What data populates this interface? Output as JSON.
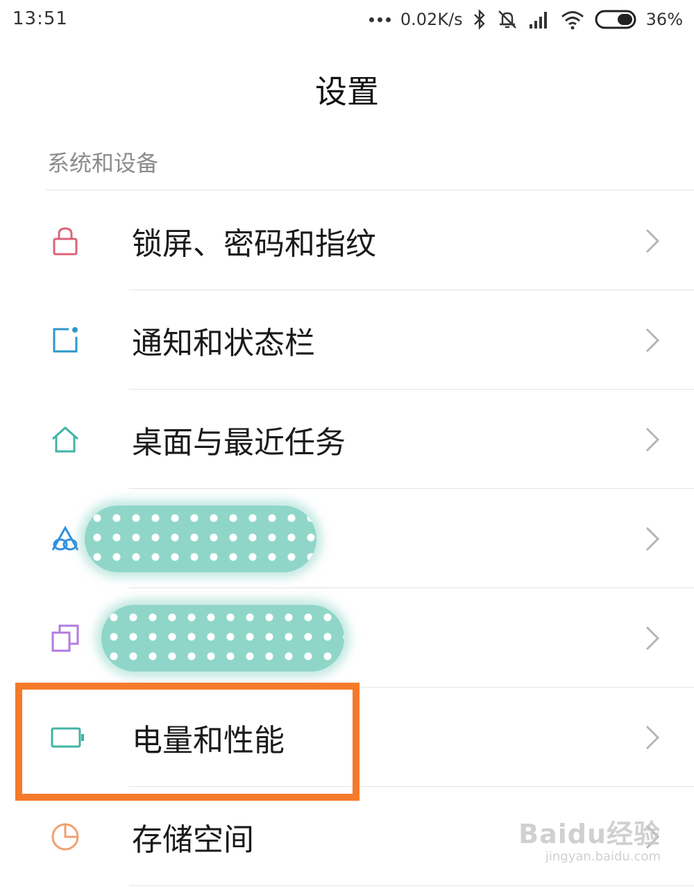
{
  "status_bar": {
    "time": "13:51",
    "net_speed": "0.02K/s",
    "battery": "36%",
    "icons": [
      "more-dots-icon",
      "bluetooth-icon",
      "silent-bell-icon",
      "signal-icon",
      "wifi-icon",
      "battery-saver-toggle-icon"
    ]
  },
  "header": {
    "title": "设置"
  },
  "section": {
    "title": "系统和设备"
  },
  "menu": {
    "items": [
      {
        "label": "锁屏、密码和指纹",
        "icon": "lock-icon",
        "icon_color": "#d9657a"
      },
      {
        "label": "通知和状态栏",
        "icon": "notification-icon",
        "icon_color": "#2e97c9"
      },
      {
        "label": "桌面与最近任务",
        "icon": "home-icon",
        "icon_color": "#3fb4a4"
      },
      {
        "label": "",
        "icon": "ai-assistant-icon",
        "icon_color": "#2f8fe0"
      },
      {
        "label": "",
        "icon": "dual-apps-icon",
        "icon_color": "#b07be0"
      },
      {
        "label": "电量和性能",
        "icon": "battery-icon",
        "icon_color": "#3fb4a4"
      },
      {
        "label": "存储空间",
        "icon": "storage-pie-icon",
        "icon_color": "#f0a070"
      }
    ]
  },
  "highlight_color": "#f47a2a",
  "watermark": {
    "main": "Baidu经验",
    "sub": "jingyan.baidu.com"
  }
}
